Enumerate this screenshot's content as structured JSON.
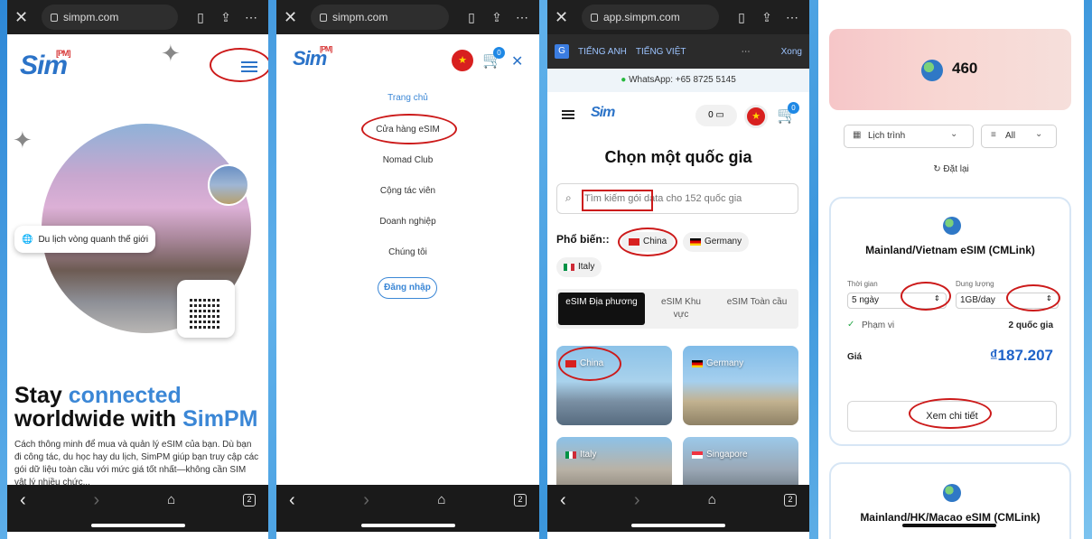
{
  "phone1": {
    "url": "simpm.com",
    "logo_text": "Sim",
    "logo_sup": "[PM]",
    "chip_label": "Du lịch vòng quanh thế giới",
    "headline_1a": "Stay ",
    "headline_1b": "connected",
    "headline_2a": "worldwide with ",
    "headline_2b": "SimPM",
    "paragraph": "Cách thông minh để mua và quản lý eSIM của bạn. Dù bạn đi công tác, du học hay du lịch, SimPM giúp bạn truy cập các gói dữ liệu toàn cầu với mức giá tốt nhất—không cần SIM vật lý nhiều chức...",
    "tabs_count": "2"
  },
  "phone2": {
    "url": "simpm.com",
    "logo_text": "Sim",
    "logo_sup": "[PM]",
    "cart_count": "0",
    "menu": [
      "Trang chủ",
      "Cửa hàng eSIM",
      "Nomad Club",
      "Cộng tác viên",
      "Doanh nghiệp",
      "Chúng tôi"
    ],
    "login": "Đăng nhập",
    "tabs_count": "2"
  },
  "phone3": {
    "url": "app.simpm.com",
    "lang_en": "TIẾNG ANH",
    "lang_vi": "TIẾNG VIỆT",
    "done": "Xong",
    "whatsapp": "WhatsApp: +65 8725 5145",
    "wallet": "0",
    "cart_count": "0",
    "heading": "Chọn một quốc gia",
    "search_placeholder": "Tìm kiếm gói data cho 152 quốc gia",
    "popular_label": "Phổ biến::",
    "popular": [
      "China",
      "Germany",
      "Italy"
    ],
    "tabs": [
      "eSIM Địa phương",
      "eSIM Khu vực",
      "eSIM Toàn cầu"
    ],
    "cards": [
      "China",
      "Germany",
      "Italy",
      "Singapore"
    ],
    "tabs_count": "2"
  },
  "phone4": {
    "count": "460",
    "filter_itinerary": "Lịch trình",
    "filter_all": "All",
    "reset": "Đặt lại",
    "plan1": {
      "title": "Mainland/Vietnam eSIM (CMLink)",
      "duration_label": "Thời gian",
      "duration_value": "5 ngày",
      "capacity_label": "Dung lượng",
      "capacity_value": "1GB/day",
      "coverage_label": "Phạm vi",
      "coverage_value": "2 quốc gia",
      "price_label": "Giá",
      "price_value": "₫187.207",
      "details": "Xem chi tiết"
    },
    "plan2": {
      "title": "Mainland/HK/Macao eSIM (CMLink)"
    }
  },
  "colors": {
    "brand_blue": "#2b73c8",
    "annotation_red": "#cc1a1a",
    "price_blue": "#1e62c8"
  }
}
